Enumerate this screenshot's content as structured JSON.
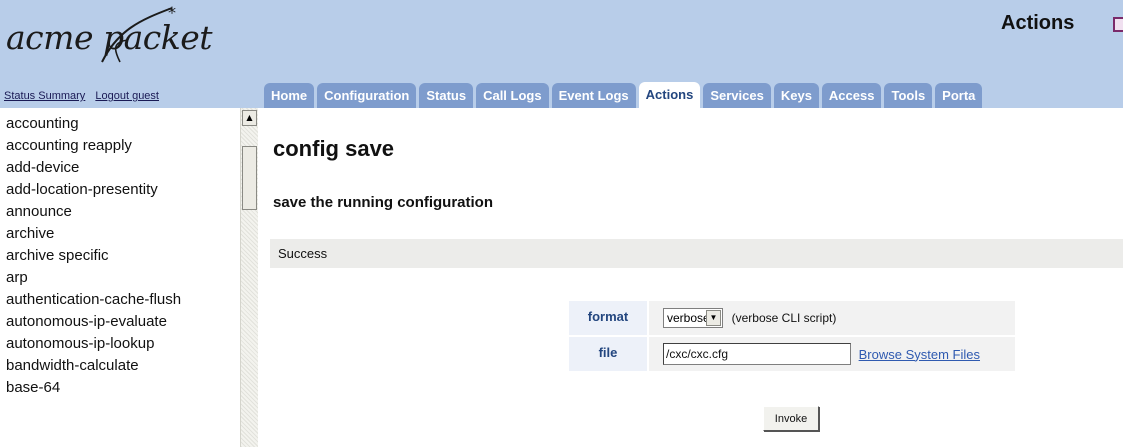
{
  "brand": {
    "logo_text": "acme packet"
  },
  "header": {
    "links": [
      "Status Summary",
      "Logout guest"
    ],
    "page_heading": "Actions"
  },
  "tabs": [
    {
      "label": "Home"
    },
    {
      "label": "Configuration"
    },
    {
      "label": "Status"
    },
    {
      "label": "Call Logs"
    },
    {
      "label": "Event Logs"
    },
    {
      "label": "Actions",
      "active": true
    },
    {
      "label": "Services"
    },
    {
      "label": "Keys"
    },
    {
      "label": "Access"
    },
    {
      "label": "Tools"
    },
    {
      "label": "Porta"
    }
  ],
  "sidebar": {
    "items": [
      "accounting",
      "accounting reapply",
      "add-device",
      "add-location-presentity",
      "announce",
      "archive",
      "archive specific",
      "arp",
      "authentication-cache-flush",
      "autonomous-ip-evaluate",
      "autonomous-ip-lookup",
      "bandwidth-calculate",
      "base-64"
    ]
  },
  "main": {
    "title": "config save",
    "subtitle": "save the running configuration",
    "status": "Success",
    "params": {
      "format": {
        "label": "format",
        "selected": "verbose",
        "hint": "(verbose CLI script)"
      },
      "file": {
        "label": "file",
        "value": "/cxc/cxc.cfg",
        "link": "Browse System Files"
      }
    },
    "invoke_label": "Invoke"
  },
  "colors": {
    "header_bg": "#b8cde9",
    "tab_bg": "#7e9ccd",
    "tab_active_text": "#23467f",
    "link": "#2f5ab0",
    "status_bg": "#ececea"
  },
  "icons": [
    "scroll-up-arrow-icon",
    "dropdown-arrow-icon",
    "actions-page-icon"
  ]
}
